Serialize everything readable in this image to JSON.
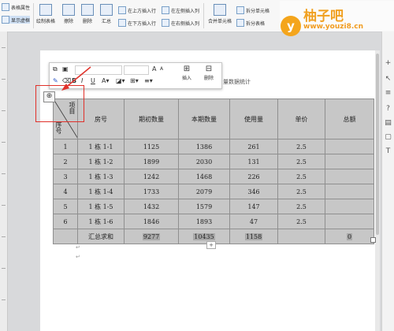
{
  "ribbon": {
    "left_top": "表格属性",
    "left_bottom": "显示虚框",
    "draw_table": "绘制表格",
    "eraser": "擦除",
    "delete": "删除",
    "summary": "汇总",
    "insert_above": "在上方插入行",
    "insert_below": "在下方插入行",
    "insert_left": "在左侧插入列",
    "insert_right": "在右侧插入列",
    "merge": "合并单元格",
    "split_cell": "拆分单元格",
    "split_table": "拆分表格"
  },
  "watermark": {
    "logo": "y",
    "title": "柚子吧",
    "url": "www.youzi8.cn"
  },
  "floating_toolbar": {
    "insert": "插入",
    "delete": "删除"
  },
  "doc_text": "量数据统计",
  "anchor_icon": "⊕",
  "add_row_icon": "+",
  "table": {
    "corner_top": "项目",
    "corner_bottom": "序号",
    "headers": [
      "房号",
      "期初数量",
      "本期数量",
      "使用量",
      "单价",
      "总额"
    ],
    "rows": [
      {
        "no": "1",
        "room": "1 栋 1-1",
        "start": "1125",
        "current": "1386",
        "used": "261",
        "price": "2.5",
        "total": ""
      },
      {
        "no": "2",
        "room": "1 栋 1-2",
        "start": "1899",
        "current": "2030",
        "used": "131",
        "price": "2.5",
        "total": ""
      },
      {
        "no": "3",
        "room": "1 栋 1-3",
        "start": "1242",
        "current": "1468",
        "used": "226",
        "price": "2.5",
        "total": ""
      },
      {
        "no": "4",
        "room": "1 栋 1-4",
        "start": "1733",
        "current": "2079",
        "used": "346",
        "price": "2.5",
        "total": ""
      },
      {
        "no": "5",
        "room": "1 栋 1-5",
        "start": "1432",
        "current": "1579",
        "used": "147",
        "price": "2.5",
        "total": ""
      },
      {
        "no": "6",
        "room": "1 栋 1-6",
        "start": "1846",
        "current": "1893",
        "used": "47",
        "price": "2.5",
        "total": ""
      }
    ],
    "sum_row": {
      "label": "汇总求和",
      "start": "9277",
      "current": "10435",
      "used": "1158",
      "price": "",
      "total": "0"
    }
  },
  "colors": {
    "highlight": "#e0312a",
    "table_bg": "#c7c7c7",
    "watermark": "#f0a020"
  }
}
